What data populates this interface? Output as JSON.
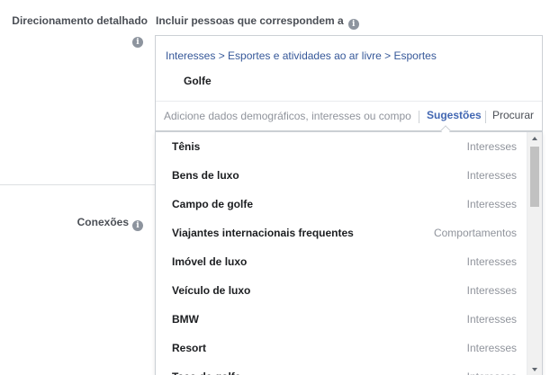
{
  "section": {
    "label": "Direcionamento detalhado",
    "include_label": "Incluir pessoas que correspondem a",
    "connections_label": "Conexões"
  },
  "targeting": {
    "breadcrumb": "Interesses > Esportes e atividades ao ar livre > Esportes",
    "selected": "Golfe",
    "search_placeholder": "Adicione dados demográficos, interesses ou compo",
    "tab_suggestions": "Sugestões",
    "tab_browse": "Procurar"
  },
  "suggestions": [
    {
      "name": "Tênis",
      "category": "Interesses"
    },
    {
      "name": "Bens de luxo",
      "category": "Interesses"
    },
    {
      "name": "Campo de golfe",
      "category": "Interesses"
    },
    {
      "name": "Viajantes internacionais frequentes",
      "category": "Comportamentos"
    },
    {
      "name": "Imóvel de luxo",
      "category": "Interesses"
    },
    {
      "name": "Veículo de luxo",
      "category": "Interesses"
    },
    {
      "name": "BMW",
      "category": "Interesses"
    },
    {
      "name": "Resort",
      "category": "Interesses"
    },
    {
      "name": "Taco de golfe",
      "category": "Interesses"
    }
  ],
  "icons": {
    "info": "info-icon"
  },
  "colors": {
    "link": "#365899",
    "accent": "#4267b2",
    "muted": "#90949c"
  }
}
